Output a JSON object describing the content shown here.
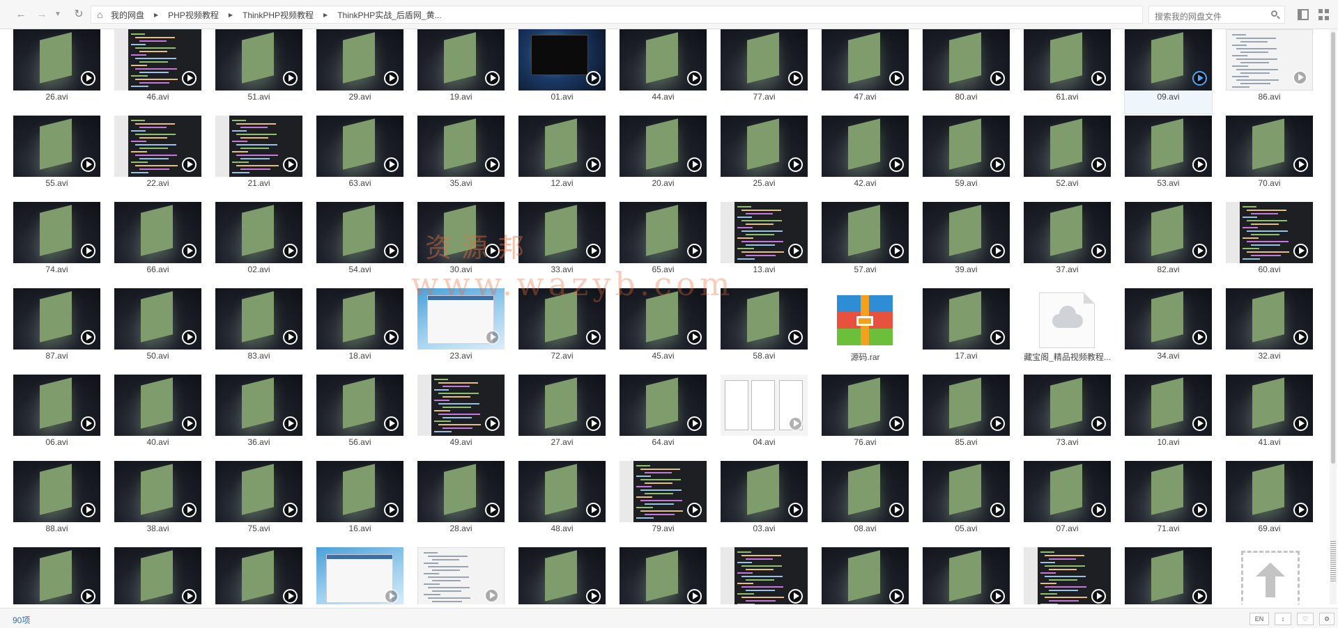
{
  "toolbar": {
    "breadcrumb": [
      "我的网盘",
      "PHP视频教程",
      "ThinkPHP视频教程",
      "ThinkPHP实战_后盾网_黄..."
    ],
    "search_placeholder": "搜索我的网盘文件",
    "icons": [
      "arrow-left-icon",
      "arrow-right-icon",
      "chevron-down-icon",
      "refresh-icon",
      "home-icon",
      "search-icon",
      "layout-icon",
      "grid-icon"
    ]
  },
  "files": [
    {
      "name": "26.avi",
      "thumb": "default"
    },
    {
      "name": "46.avi",
      "thumb": "code"
    },
    {
      "name": "51.avi",
      "thumb": "default"
    },
    {
      "name": "29.avi",
      "thumb": "default"
    },
    {
      "name": "19.avi",
      "thumb": "default"
    },
    {
      "name": "01.avi",
      "thumb": "dark"
    },
    {
      "name": "44.avi",
      "thumb": "default"
    },
    {
      "name": "77.avi",
      "thumb": "default"
    },
    {
      "name": "47.avi",
      "thumb": "default"
    },
    {
      "name": "80.avi",
      "thumb": "default"
    },
    {
      "name": "61.avi",
      "thumb": "default"
    },
    {
      "name": "09.avi",
      "thumb": "default",
      "selected": true
    },
    {
      "name": "86.avi",
      "thumb": "light"
    },
    {
      "name": "55.avi",
      "thumb": "default"
    },
    {
      "name": "22.avi",
      "thumb": "code"
    },
    {
      "name": "21.avi",
      "thumb": "code"
    },
    {
      "name": "63.avi",
      "thumb": "default"
    },
    {
      "name": "35.avi",
      "thumb": "default"
    },
    {
      "name": "12.avi",
      "thumb": "default"
    },
    {
      "name": "20.avi",
      "thumb": "default"
    },
    {
      "name": "25.avi",
      "thumb": "default"
    },
    {
      "name": "42.avi",
      "thumb": "default"
    },
    {
      "name": "59.avi",
      "thumb": "default"
    },
    {
      "name": "52.avi",
      "thumb": "default"
    },
    {
      "name": "53.avi",
      "thumb": "default"
    },
    {
      "name": "70.avi",
      "thumb": "default"
    },
    {
      "name": "74.avi",
      "thumb": "default"
    },
    {
      "name": "66.avi",
      "thumb": "default"
    },
    {
      "name": "02.avi",
      "thumb": "default"
    },
    {
      "name": "54.avi",
      "thumb": "default"
    },
    {
      "name": "30.avi",
      "thumb": "default"
    },
    {
      "name": "33.avi",
      "thumb": "default"
    },
    {
      "name": "65.avi",
      "thumb": "default"
    },
    {
      "name": "13.avi",
      "thumb": "code"
    },
    {
      "name": "57.avi",
      "thumb": "default"
    },
    {
      "name": "39.avi",
      "thumb": "default"
    },
    {
      "name": "37.avi",
      "thumb": "default"
    },
    {
      "name": "82.avi",
      "thumb": "default"
    },
    {
      "name": "60.avi",
      "thumb": "code"
    },
    {
      "name": "87.avi",
      "thumb": "default"
    },
    {
      "name": "50.avi",
      "thumb": "default"
    },
    {
      "name": "83.avi",
      "thumb": "default"
    },
    {
      "name": "18.avi",
      "thumb": "default"
    },
    {
      "name": "23.avi",
      "thumb": "web"
    },
    {
      "name": "72.avi",
      "thumb": "default"
    },
    {
      "name": "45.avi",
      "thumb": "default"
    },
    {
      "name": "58.avi",
      "thumb": "default"
    },
    {
      "name": "源码.rar",
      "thumb": "rar"
    },
    {
      "name": "17.avi",
      "thumb": "default"
    },
    {
      "name": "藏宝阁_精品视频教程...",
      "thumb": "doc"
    },
    {
      "name": "34.avi",
      "thumb": "default"
    },
    {
      "name": "32.avi",
      "thumb": "default"
    },
    {
      "name": "06.avi",
      "thumb": "default"
    },
    {
      "name": "40.avi",
      "thumb": "default"
    },
    {
      "name": "36.avi",
      "thumb": "default"
    },
    {
      "name": "56.avi",
      "thumb": "default"
    },
    {
      "name": "49.avi",
      "thumb": "code"
    },
    {
      "name": "27.avi",
      "thumb": "default"
    },
    {
      "name": "64.avi",
      "thumb": "default"
    },
    {
      "name": "04.avi",
      "thumb": "ide"
    },
    {
      "name": "76.avi",
      "thumb": "default"
    },
    {
      "name": "85.avi",
      "thumb": "default"
    },
    {
      "name": "73.avi",
      "thumb": "default"
    },
    {
      "name": "10.avi",
      "thumb": "default"
    },
    {
      "name": "41.avi",
      "thumb": "default"
    },
    {
      "name": "88.avi",
      "thumb": "default"
    },
    {
      "name": "38.avi",
      "thumb": "default"
    },
    {
      "name": "75.avi",
      "thumb": "default"
    },
    {
      "name": "16.avi",
      "thumb": "default"
    },
    {
      "name": "28.avi",
      "thumb": "default"
    },
    {
      "name": "48.avi",
      "thumb": "default"
    },
    {
      "name": "79.avi",
      "thumb": "code"
    },
    {
      "name": "03.avi",
      "thumb": "default"
    },
    {
      "name": "08.avi",
      "thumb": "default"
    },
    {
      "name": "05.avi",
      "thumb": "default"
    },
    {
      "name": "07.avi",
      "thumb": "default"
    },
    {
      "name": "71.avi",
      "thumb": "default"
    },
    {
      "name": "69.avi",
      "thumb": "default"
    },
    {
      "name": "",
      "thumb": "default"
    },
    {
      "name": "",
      "thumb": "default"
    },
    {
      "name": "",
      "thumb": "default"
    },
    {
      "name": "",
      "thumb": "web"
    },
    {
      "name": "",
      "thumb": "light"
    },
    {
      "name": "",
      "thumb": "default"
    },
    {
      "name": "",
      "thumb": "default"
    },
    {
      "name": "",
      "thumb": "code"
    },
    {
      "name": "",
      "thumb": "default"
    },
    {
      "name": "",
      "thumb": "default"
    },
    {
      "name": "",
      "thumb": "code"
    },
    {
      "name": "",
      "thumb": "default"
    },
    {
      "name": "",
      "thumb": "upload"
    }
  ],
  "watermark": {
    "line1": "资源邦",
    "line2": "www.wazyb.com"
  },
  "status": {
    "count": "90项",
    "buttons": [
      "EN",
      "sort-icon",
      "heart-icon",
      "gear-icon"
    ]
  },
  "colors": {
    "accent": "#2e6fb7",
    "selected_bg": "#eef5fb",
    "play_active": "#4ea7f5"
  }
}
